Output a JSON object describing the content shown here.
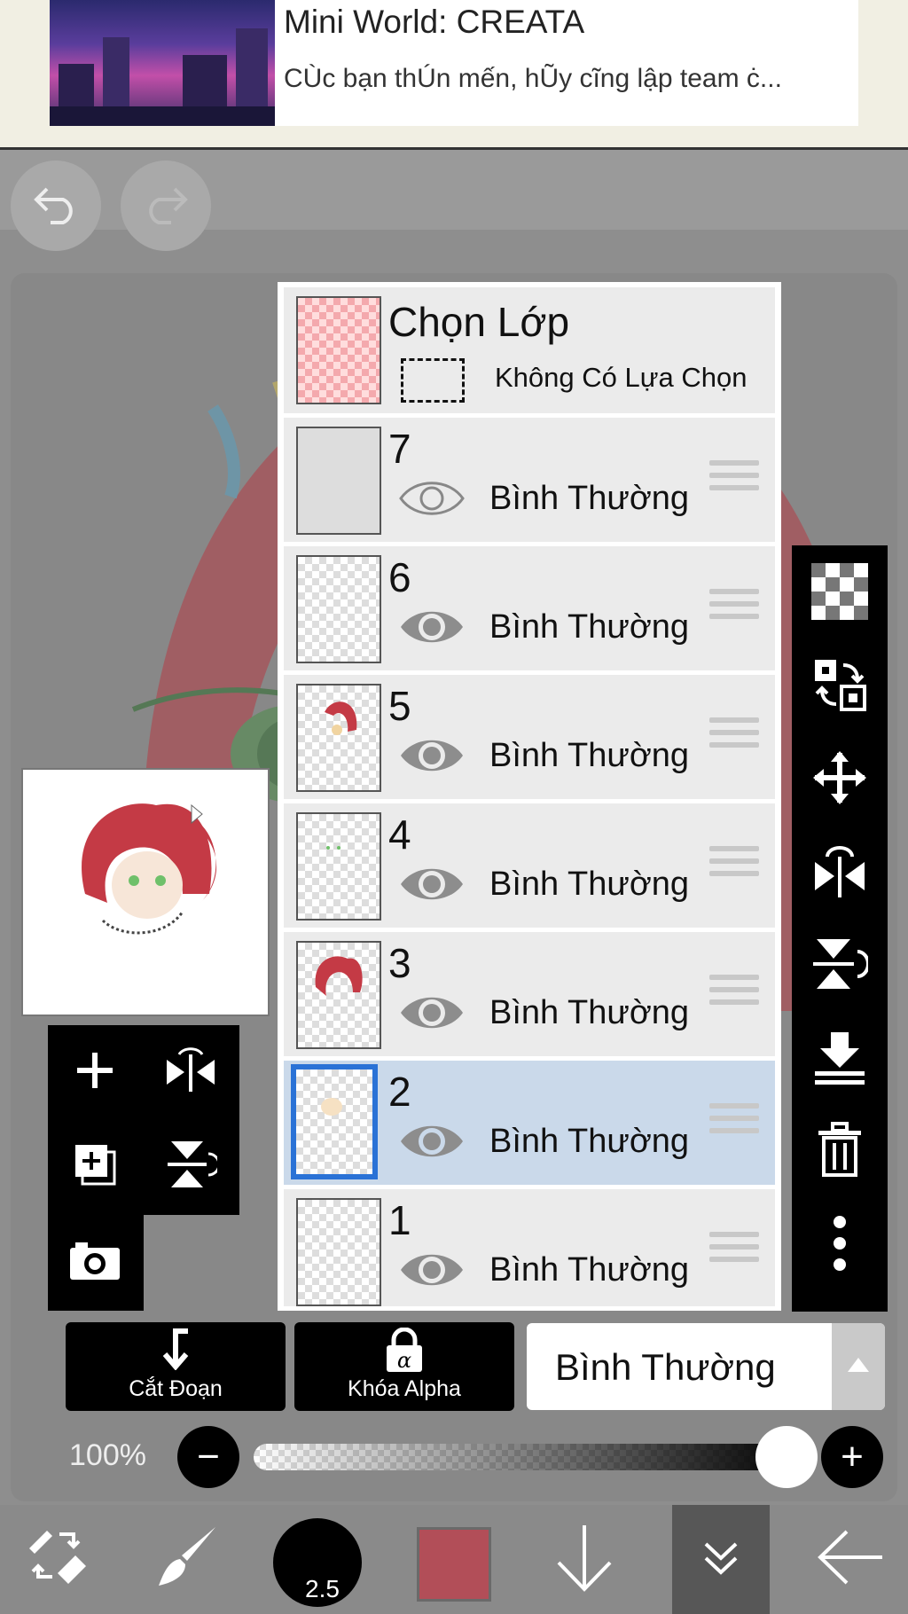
{
  "ad": {
    "title": "Mini World: CREATA",
    "subtitle": "CÙc bạn thÚn mến, hŨy cĩng lập team ċ..."
  },
  "layer_panel": {
    "header": {
      "title": "Chọn Lớp",
      "selection_label": "Không Có Lựa Chọn"
    },
    "layers": [
      {
        "number": "7",
        "mode": "Bình Thường",
        "visible": false,
        "active": false
      },
      {
        "number": "6",
        "mode": "Bình Thường",
        "visible": true,
        "active": false
      },
      {
        "number": "5",
        "mode": "Bình Thường",
        "visible": true,
        "active": false
      },
      {
        "number": "4",
        "mode": "Bình Thường",
        "visible": true,
        "active": false
      },
      {
        "number": "3",
        "mode": "Bình Thường",
        "visible": true,
        "active": false
      },
      {
        "number": "2",
        "mode": "Bình Thường",
        "visible": true,
        "active": true
      },
      {
        "number": "1",
        "mode": "Bình Thường",
        "visible": true,
        "active": false
      }
    ]
  },
  "actions": {
    "clipping_label": "Cắt Đoạn",
    "alpha_lock_label": "Khóa Alpha",
    "blend_mode": "Bình Thường"
  },
  "opacity": {
    "label": "100%",
    "value": 1.0
  },
  "bottom_bar": {
    "brush_size": "2.5",
    "color": "#b24e58"
  },
  "icons": {
    "undo": "undo-icon",
    "redo": "redo-icon",
    "add_layer": "plus-icon",
    "flip_h": "flip-horizontal-icon",
    "add_copy": "add-copy-layer-icon",
    "flip_v": "flip-vertical-icon",
    "camera": "camera-icon",
    "transparent": "checkerboard-icon",
    "move_swap": "swap-layer-icon",
    "move": "move-arrows-icon",
    "merge": "merge-down-icon",
    "delete": "trash-icon",
    "more": "more-vertical-icon"
  }
}
